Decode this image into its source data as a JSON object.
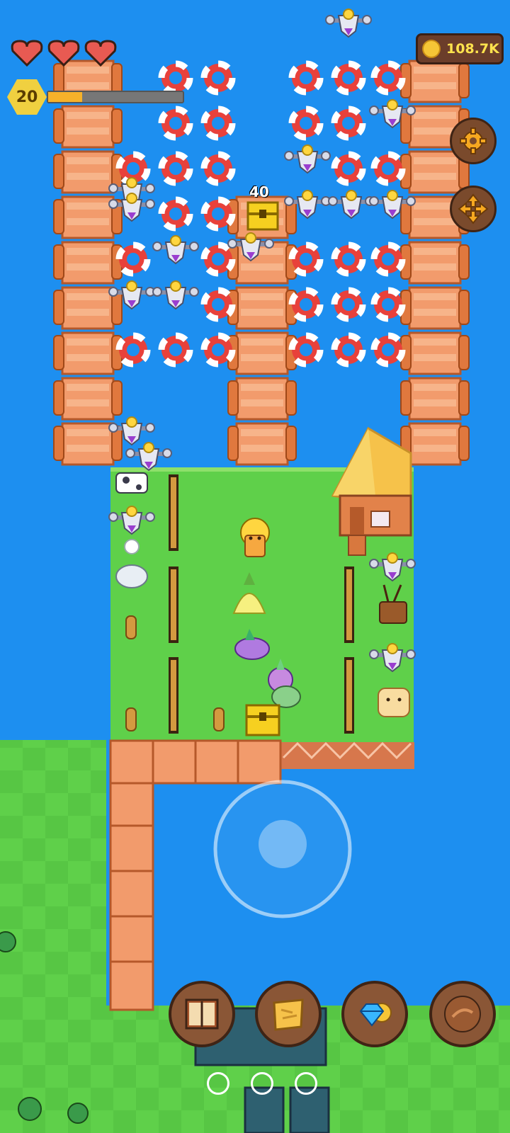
{
  "hud": {
    "hearts": 3,
    "level": "20",
    "xp_fraction": 0.25,
    "coins": "108.7K",
    "floating_value": "40"
  },
  "icons": {
    "settings": "gear-icon",
    "move": "move-arrows-icon",
    "book": "book-icon",
    "map": "map-scroll-icon",
    "shop": "gem-coin-icon",
    "bag": "leather-bag-icon"
  },
  "colors": {
    "water": "#1d8ff0",
    "grass": "#5fd04a",
    "dock": "#f29b6c",
    "heart": "#e85a52",
    "coin": "#ffe34d"
  },
  "pagination": {
    "pages": 3
  }
}
